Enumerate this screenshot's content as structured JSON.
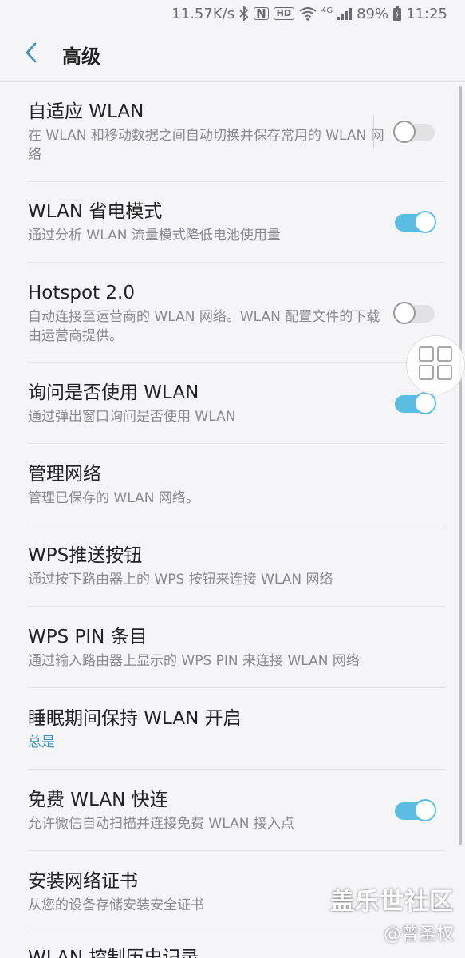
{
  "status_bar": {
    "net_speed": "11.57K/s",
    "network_type": "4G",
    "battery": "89%",
    "time": "11:25",
    "hd_badge": "HD",
    "nfc_label": "N",
    "icons": [
      "bluetooth-icon",
      "nfc-icon",
      "hd-badge",
      "wifi-icon",
      "signal-icon",
      "battery-icon"
    ]
  },
  "header": {
    "title": "高级",
    "back_icon": "chevron-left-icon"
  },
  "settings": [
    {
      "title": "自适应 WLAN",
      "summary": "在 WLAN 和移动数据之间自动切换并保存常用的 WLAN 网络",
      "toggle": false
    },
    {
      "title": "WLAN 省电模式",
      "summary": "通过分析 WLAN 流量模式降低电池使用量",
      "toggle": true
    },
    {
      "title": "Hotspot 2.0",
      "summary": "自动连接至运营商的 WLAN 网络。WLAN 配置文件的下载由运营商提供。",
      "toggle": false
    },
    {
      "title": "询问是否使用 WLAN",
      "summary": "通过弹出窗口询问是否使用 WLAN",
      "toggle": true
    },
    {
      "title": "管理网络",
      "summary": "管理已保存的 WLAN 网络。"
    },
    {
      "title": "WPS推送按钮",
      "summary": "通过按下路由器上的 WPS 按钮来连接 WLAN 网络"
    },
    {
      "title": "WPS PIN 条目",
      "summary": "通过输入路由器上显示的 WPS PIN 来连接 WLAN 网络"
    },
    {
      "title": "睡眠期间保持 WLAN 开启",
      "summary": "总是"
    },
    {
      "title": "免费 WLAN 快连",
      "summary": "允许微信自动扫描并连接免费 WLAN 接入点",
      "toggle": true
    },
    {
      "title": "安装网络证书",
      "summary": "从您的设备存储安装安全证书"
    },
    {
      "title": "WLAN 控制历史记录"
    }
  ],
  "floating_button": {
    "icon": "app-grid-icon"
  },
  "watermark": {
    "brand": "盖乐世社区",
    "user": "@曾圣权"
  },
  "colors": {
    "accent": "#5cbde3",
    "summary_accent": "#3a8fb7",
    "background": "#f5f4f7",
    "back_chevron": "#3a8fb7"
  }
}
